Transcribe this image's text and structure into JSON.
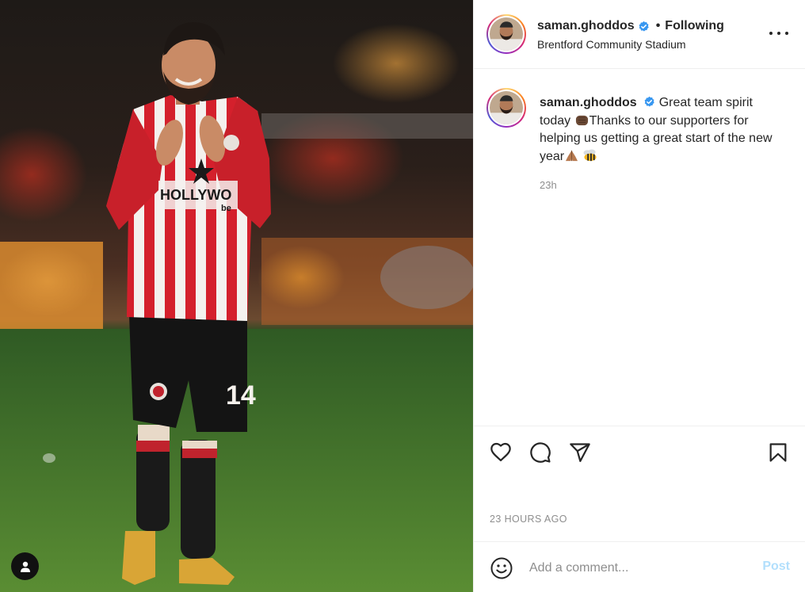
{
  "header": {
    "username": "saman.ghoddos",
    "separator": "•",
    "follow_status": "Following",
    "location": "Brentford Community Stadium",
    "more_icon": "more-horizontal-icon"
  },
  "caption": {
    "username": "saman.ghoddos",
    "text_part1": "Great team spirit today ",
    "text_part2": "Thanks to our supporters for helping us getting a great start of the new year",
    "emojis": [
      "fist-emoji",
      "folded-hands-emoji",
      "bee-emoji"
    ],
    "time": "23h"
  },
  "photo": {
    "shirt_sponsor": "HOLLYWO",
    "shirt_sponsor_sub": "be",
    "shorts_number": "14"
  },
  "actions": {
    "like_icon": "heart-icon",
    "comment_icon": "comment-icon",
    "share_icon": "paper-plane-icon",
    "save_icon": "bookmark-icon"
  },
  "timestamp": "23 HOURS AGO",
  "add_comment": {
    "placeholder": "Add a comment...",
    "post_label": "Post",
    "emoji_icon": "smiley-icon"
  },
  "colors": {
    "verified_blue": "#3897f0",
    "post_button_disabled": "#b2dffc",
    "secondary_text": "#8e8e8e"
  }
}
